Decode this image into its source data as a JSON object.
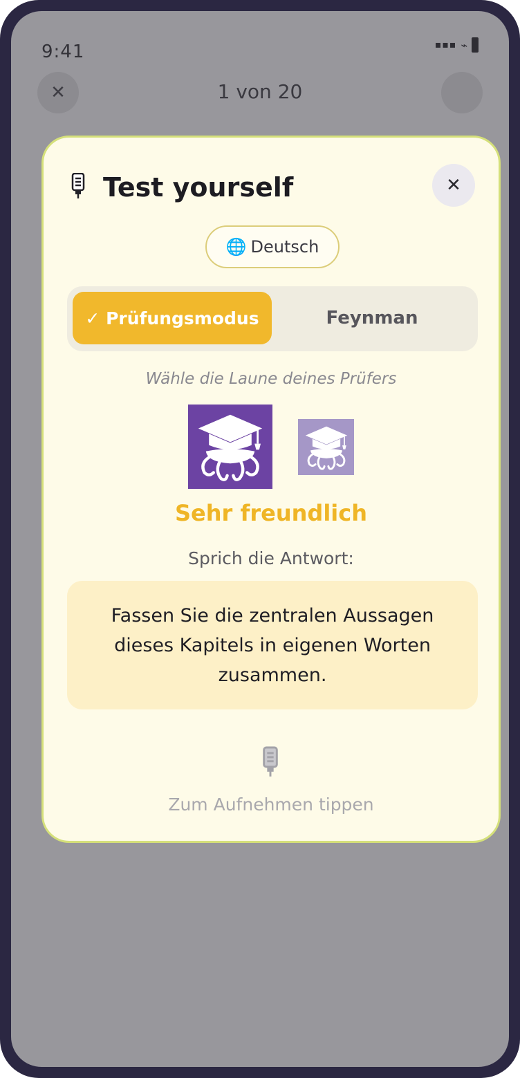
{
  "status_bar": {
    "time": "9:41"
  },
  "top_bar": {
    "progress": "1 von 20",
    "close_glyph": "✕"
  },
  "modal": {
    "title": "Test yourself",
    "close_glyph": "✕",
    "language": {
      "globe_glyph": "🌐",
      "label": "Deutsch"
    },
    "modes": [
      {
        "label": "✓ Prüfungsmodus",
        "selected": true
      },
      {
        "label": "Feynman",
        "selected": false
      }
    ],
    "mood_hint": "Wähle die Laune deines Prüfers",
    "examiners": [
      {
        "icon": "octopus-graduate-icon",
        "selected": true,
        "color": "#6c43a3"
      },
      {
        "icon": "octopus-graduate-icon",
        "selected": false,
        "color": "#a597c7"
      }
    ],
    "mood_label": "Sehr freundlich",
    "speak_prompt": "Sprich die Antwort:",
    "question": "Fassen Sie die zentralen Aussagen dieses Kapitels in eigenen Worten zusammen.",
    "record_hint": "Zum Aufnehmen tippen"
  },
  "colors": {
    "accent": "#f1b82c",
    "modal_bg": "#fefbe8",
    "modal_border": "#d5e07a",
    "question_bg": "#fdf0c7"
  }
}
